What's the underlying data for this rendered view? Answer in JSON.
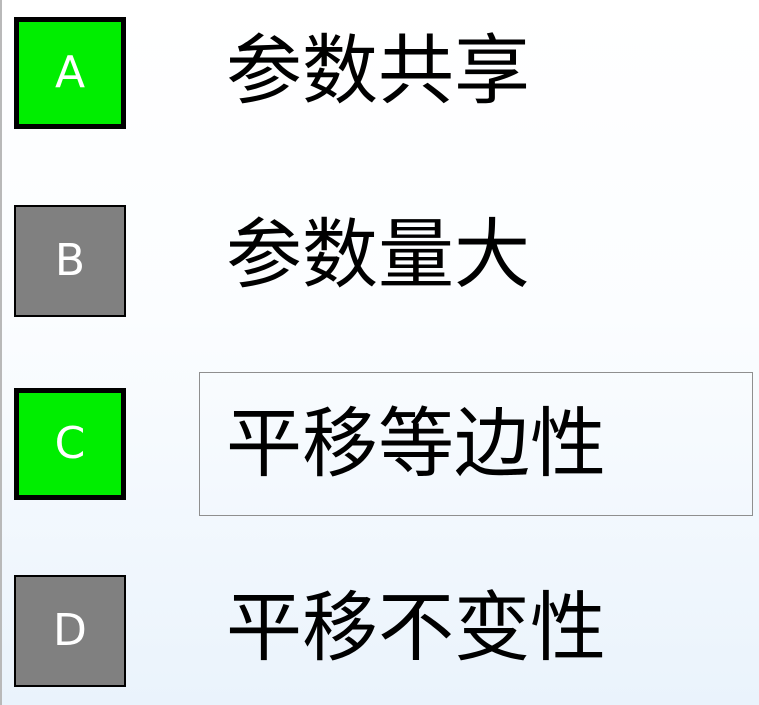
{
  "options": [
    {
      "letter": "A",
      "text": "参数共享",
      "status": "correct"
    },
    {
      "letter": "B",
      "text": "参数量大",
      "status": "neutral"
    },
    {
      "letter": "C",
      "text": "平移等边性",
      "status": "correct"
    },
    {
      "letter": "D",
      "text": "平移不变性",
      "status": "neutral"
    }
  ],
  "colors": {
    "correct": "#00ee00",
    "neutral": "#808080",
    "letter_text": "#ffffff",
    "option_text": "#000000",
    "frame": "#8f8f8f"
  }
}
